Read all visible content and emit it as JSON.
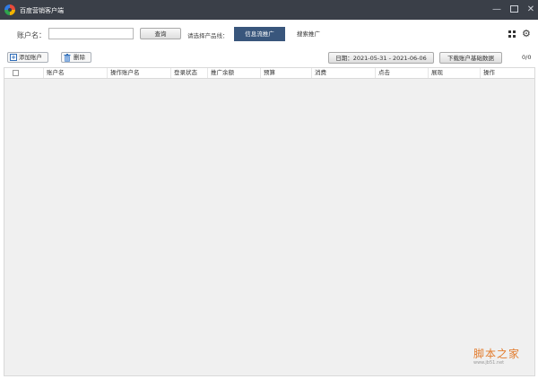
{
  "window": {
    "title": "百度营销客户端",
    "minimize_glyph": "—",
    "close_glyph": "✕"
  },
  "search": {
    "account_label": "账户名：",
    "account_value": "",
    "query_button": "查询",
    "product_line_label": "请选择产品线：",
    "tabs": [
      {
        "label": "信息流推广",
        "active": true
      },
      {
        "label": "搜索推广",
        "active": false
      }
    ]
  },
  "toolbar": {
    "add_account": "添加账户",
    "delete": "删除",
    "date_range": "日期：2021-05-31 - 2021-06-06",
    "download": "下载账户基础数据",
    "count": "0/0"
  },
  "table": {
    "columns": [
      "账户名",
      "操作账户名",
      "登录状态",
      "推广余额",
      "预算",
      "消费",
      "点击",
      "展现",
      "操作"
    ],
    "rows": []
  },
  "watermark": {
    "main": "脚本之家",
    "sub": "www.jb51.net"
  },
  "icons": {
    "app": "baidu-logo-icon",
    "grid": "grid-icon",
    "settings": "gear-icon",
    "add": "plus-icon",
    "delete": "trash-icon"
  },
  "colors": {
    "titlebar": "#3a3f48",
    "active_tab": "#39567c",
    "grid_background": "#f0f0f0",
    "watermark": "#e27b2c"
  }
}
